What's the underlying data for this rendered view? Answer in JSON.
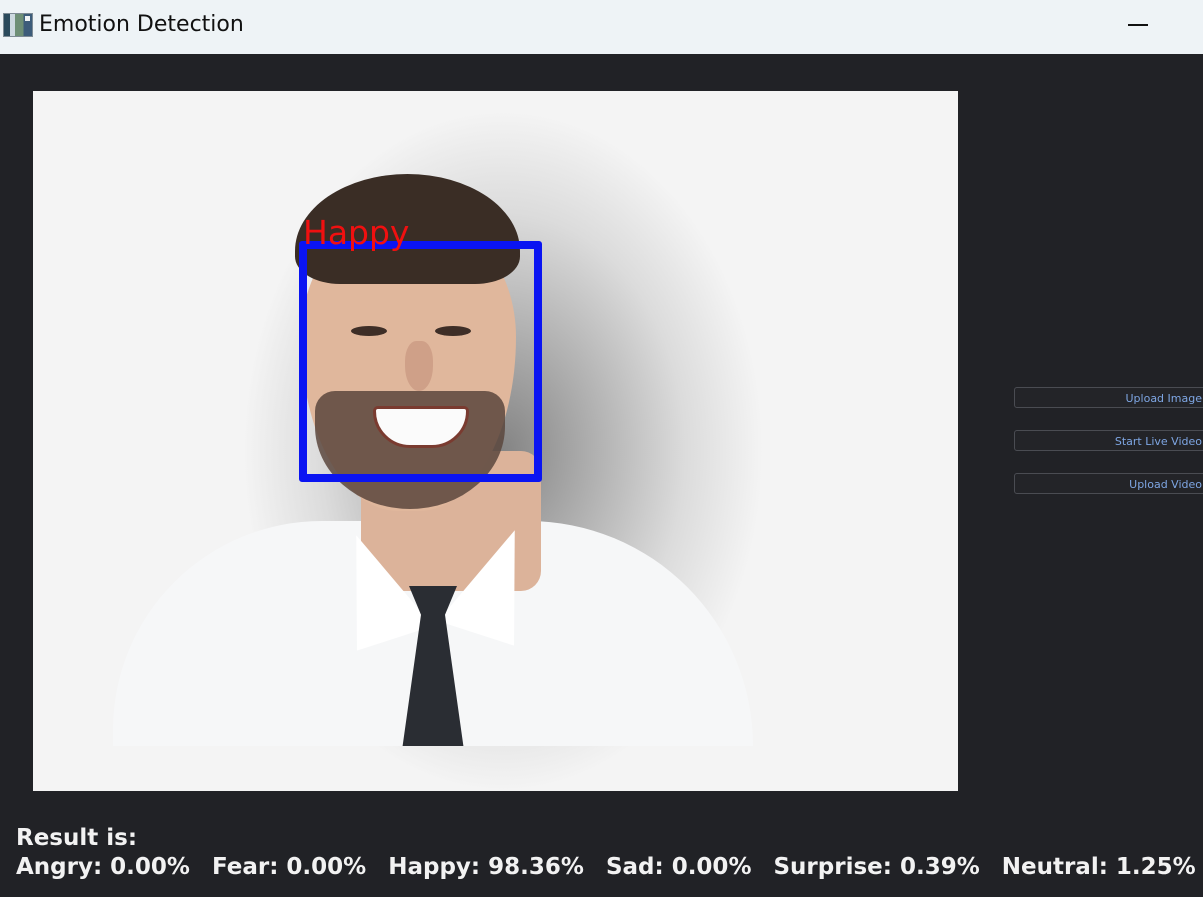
{
  "window": {
    "title": "Emotion Detection"
  },
  "image_panel": {
    "detected_label": "Happy",
    "box_color": "#0a14f2",
    "label_color": "#f01010"
  },
  "controls": {
    "upload_image": "Upload Image",
    "start_live_video": "Start Live Video",
    "upload_video": "Upload Video"
  },
  "result": {
    "title": "Result is:",
    "scores": [
      "Angry: 0.00%",
      "Fear: 0.00%",
      "Happy: 98.36%",
      "Sad: 0.00%",
      "Surprise: 0.39%",
      "Neutral: 1.25%"
    ]
  }
}
